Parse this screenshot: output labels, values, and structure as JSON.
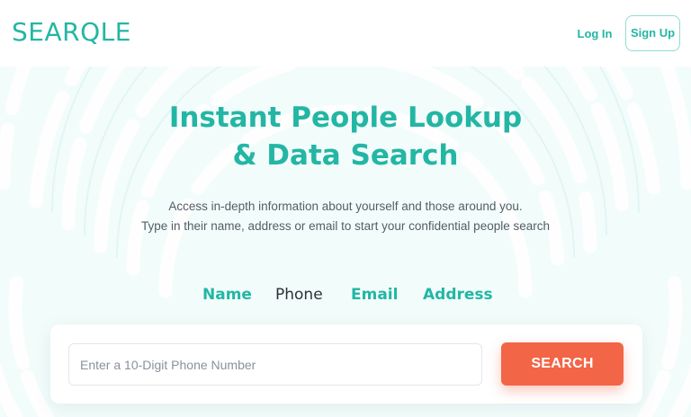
{
  "header": {
    "logo_text": "SEARQLE",
    "login_label": "Log In",
    "signup_label": "Sign Up"
  },
  "hero": {
    "headline_line1": "Instant People Lookup",
    "headline_line2": "& Data Search",
    "subtitle_line1": "Access in-depth information about yourself and those around you.",
    "subtitle_line2": "Type in their name, address or email to start your confidential people search"
  },
  "tabs": [
    {
      "label": "Name",
      "active": false
    },
    {
      "label": "Phone",
      "active": true
    },
    {
      "label": "Email",
      "active": false
    },
    {
      "label": "Address",
      "active": false
    }
  ],
  "search": {
    "placeholder": "Enter a 10-Digit Phone Number",
    "value": "",
    "button_label": "SEARCH"
  },
  "colors": {
    "brand_teal": "#23b6a4",
    "accent_orange": "#f26546",
    "active_tab_text": "#2c3136",
    "hero_background": "#f2fcfb"
  }
}
